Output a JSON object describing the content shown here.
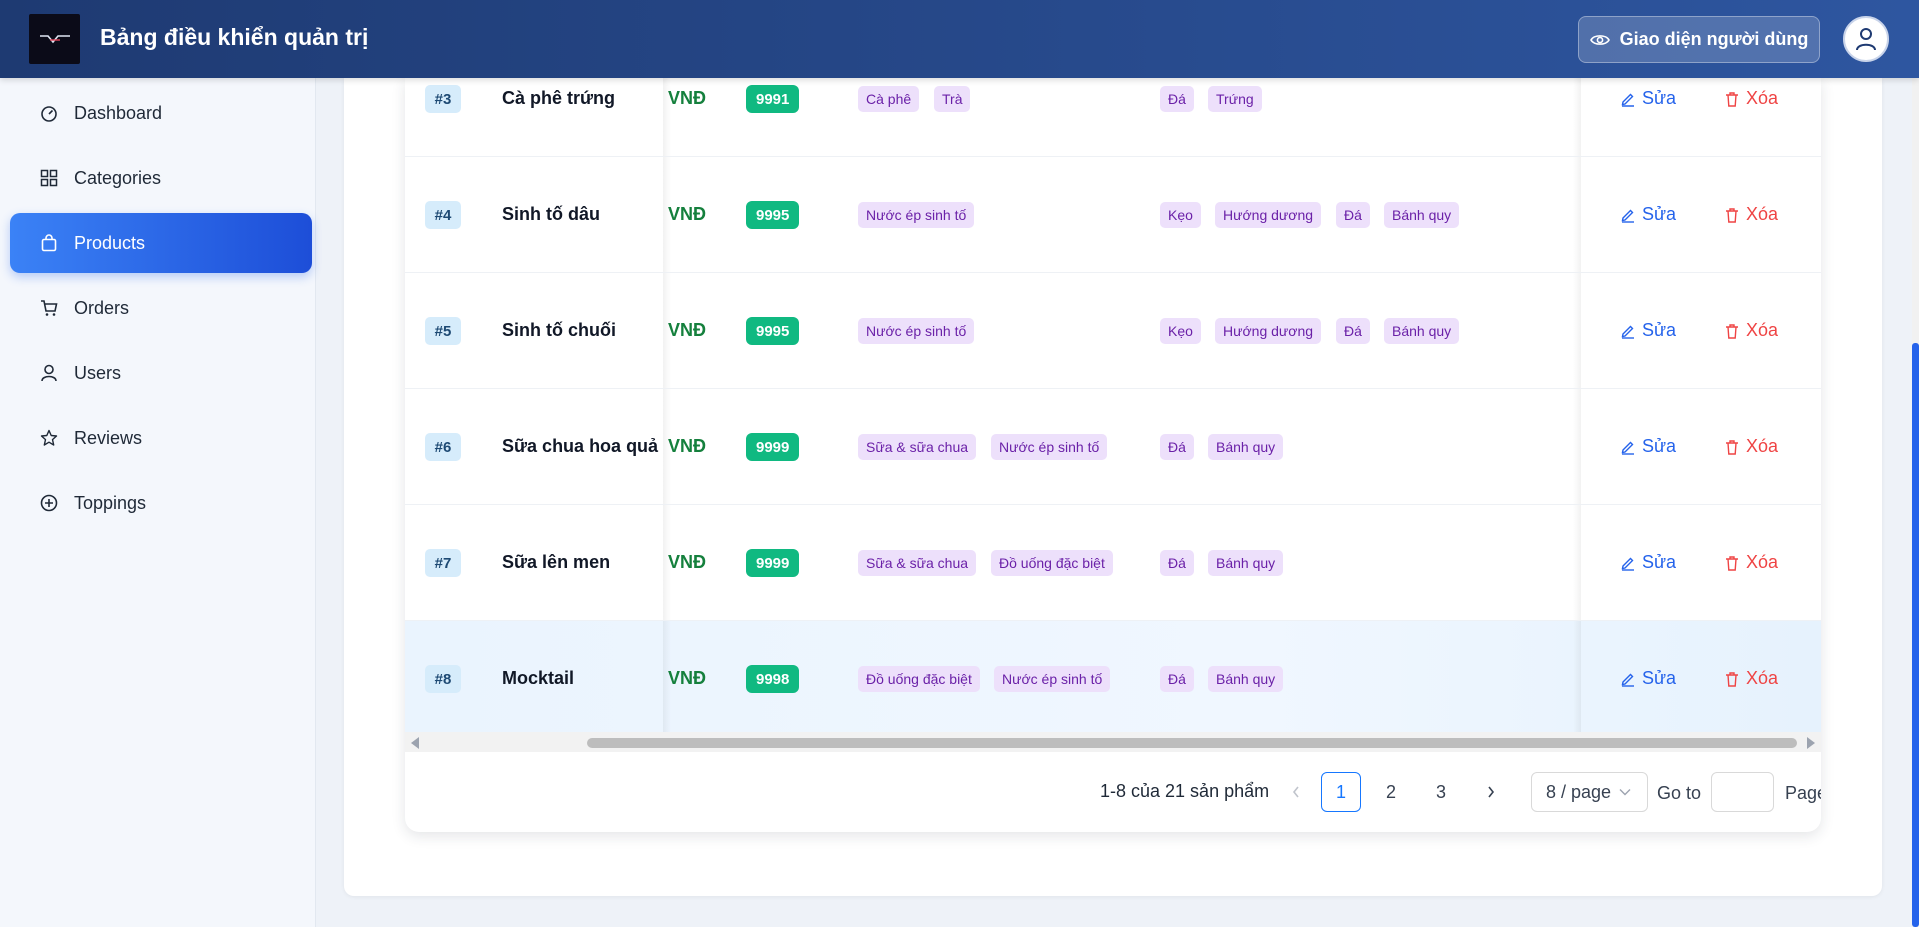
{
  "header": {
    "title": "Bảng điều khiển quản trị",
    "user_view_label": "Giao diện người dùng"
  },
  "sidebar": {
    "items": [
      {
        "label": "Dashboard",
        "icon": "dashboard-icon"
      },
      {
        "label": "Categories",
        "icon": "grid-icon"
      },
      {
        "label": "Products",
        "icon": "shopping-bag-icon",
        "active": true
      },
      {
        "label": "Orders",
        "icon": "cart-icon"
      },
      {
        "label": "Users",
        "icon": "user-icon"
      },
      {
        "label": "Reviews",
        "icon": "star-icon"
      },
      {
        "label": "Toppings",
        "icon": "plus-circle-icon"
      }
    ]
  },
  "table": {
    "rows": [
      {
        "id": "#3",
        "name": "Cà phê trứng",
        "currency": "VNĐ",
        "stock": "9991",
        "categories": [
          "Cà phê",
          "Trà"
        ],
        "toppings": [
          "Đá",
          "Trứng"
        ]
      },
      {
        "id": "#4",
        "name": "Sinh tố dâu",
        "currency": "VNĐ",
        "stock": "9995",
        "categories": [
          "Nước ép sinh tố"
        ],
        "toppings": [
          "Kẹo",
          "Hướng dương",
          "Đá",
          "Bánh quy"
        ]
      },
      {
        "id": "#5",
        "name": "Sinh tố chuối",
        "currency": "VNĐ",
        "stock": "9995",
        "categories": [
          "Nước ép sinh tố"
        ],
        "toppings": [
          "Kẹo",
          "Hướng dương",
          "Đá",
          "Bánh quy"
        ]
      },
      {
        "id": "#6",
        "name": "Sữa chua hoa quả",
        "currency": "VNĐ",
        "stock": "9999",
        "categories": [
          "Sữa & sữa chua",
          "Nước ép sinh tố"
        ],
        "toppings": [
          "Đá",
          "Bánh quy"
        ]
      },
      {
        "id": "#7",
        "name": "Sữa lên men",
        "currency": "VNĐ",
        "stock": "9999",
        "categories": [
          "Sữa & sữa chua",
          "Đồ uống đặc biệt"
        ],
        "toppings": [
          "Đá",
          "Bánh quy"
        ]
      },
      {
        "id": "#8",
        "name": "Mocktail",
        "currency": "VNĐ",
        "stock": "9998",
        "categories": [
          "Đồ uống đặc biệt",
          "Nước ép sinh tố"
        ],
        "toppings": [
          "Đá",
          "Bánh quy"
        ]
      }
    ],
    "edit_label": "Sửa",
    "delete_label": "Xóa"
  },
  "pagination": {
    "total_text": "1-8 của 21 sản phẩm",
    "pages": [
      "1",
      "2",
      "3"
    ],
    "current_page": "1",
    "page_size": "8 / page",
    "goto_label": "Go to",
    "page_label": "Page"
  },
  "colors": {
    "header_start": "#1e3a72",
    "header_end": "#2e56a0",
    "active_menu": "#2563eb",
    "stock_badge": "#10b981",
    "currency": "#15803d",
    "tag_bg": "#ede0fb",
    "edit": "#2563eb",
    "delete": "#ef4444"
  }
}
